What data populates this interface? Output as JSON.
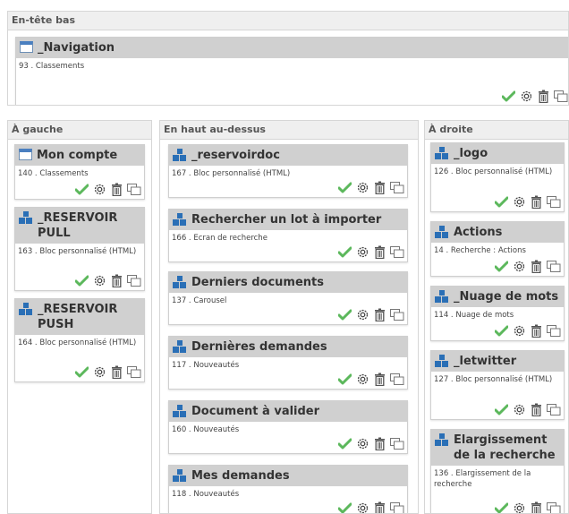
{
  "zones": {
    "top": {
      "title": "En-tête bas"
    },
    "left": {
      "title": "À gauche"
    },
    "center": {
      "title": "En haut au-dessus"
    },
    "right": {
      "title": "À droite"
    }
  },
  "top_cards": [
    {
      "title": "_Navigation",
      "desc": "93 . Classements",
      "icon": "page-icon"
    }
  ],
  "left_cards": [
    {
      "title": "Mon compte",
      "desc": "140 . Classements",
      "icon": "page-icon"
    },
    {
      "title": "_RESERVOIR PULL",
      "desc": "163 . Bloc personnalisé (HTML)",
      "icon": "blocks-icon"
    },
    {
      "title": "_RESERVOIR PUSH",
      "desc": "164 . Bloc personnalisé (HTML)",
      "icon": "blocks-icon"
    }
  ],
  "center_cards": [
    {
      "title": "_reservoirdoc",
      "desc": "167 . Bloc personnalisé (HTML)",
      "icon": "blocks-icon"
    },
    {
      "title": "Rechercher un lot à importer",
      "desc": "166 . Ecran de recherche",
      "icon": "blocks-icon"
    },
    {
      "title": "Derniers documents",
      "desc": "137 . Carousel",
      "icon": "blocks-icon"
    },
    {
      "title": "Dernières demandes",
      "desc": "117 . Nouveautés",
      "icon": "blocks-icon"
    },
    {
      "title": "Document à valider",
      "desc": "160 . Nouveautés",
      "icon": "blocks-icon"
    },
    {
      "title": "Mes demandes",
      "desc": "118 . Nouveautés",
      "icon": "blocks-icon"
    }
  ],
  "right_cards": [
    {
      "title": "_logo",
      "desc": "126 . Bloc personnalisé (HTML)",
      "icon": "blocks-icon"
    },
    {
      "title": "Actions",
      "desc": "14 . Recherche : Actions",
      "icon": "blocks-icon"
    },
    {
      "title": "_Nuage de mots",
      "desc": "114 . Nuage de mots",
      "icon": "blocks-icon"
    },
    {
      "title": "_letwitter",
      "desc": "127 . Bloc personnalisé (HTML)",
      "icon": "blocks-icon"
    },
    {
      "title": "Elargissement de la recherche",
      "desc": "136 . Elargissement de la recherche",
      "icon": "blocks-icon"
    }
  ],
  "actions": [
    "validate-icon",
    "settings-icon",
    "delete-icon",
    "duplicate-icon"
  ],
  "colors": {
    "check": "#5cb85c",
    "header": "#d0d0d0",
    "zone_bg": "#f7f7f7",
    "blocks_icon": "#2a6fb6"
  }
}
